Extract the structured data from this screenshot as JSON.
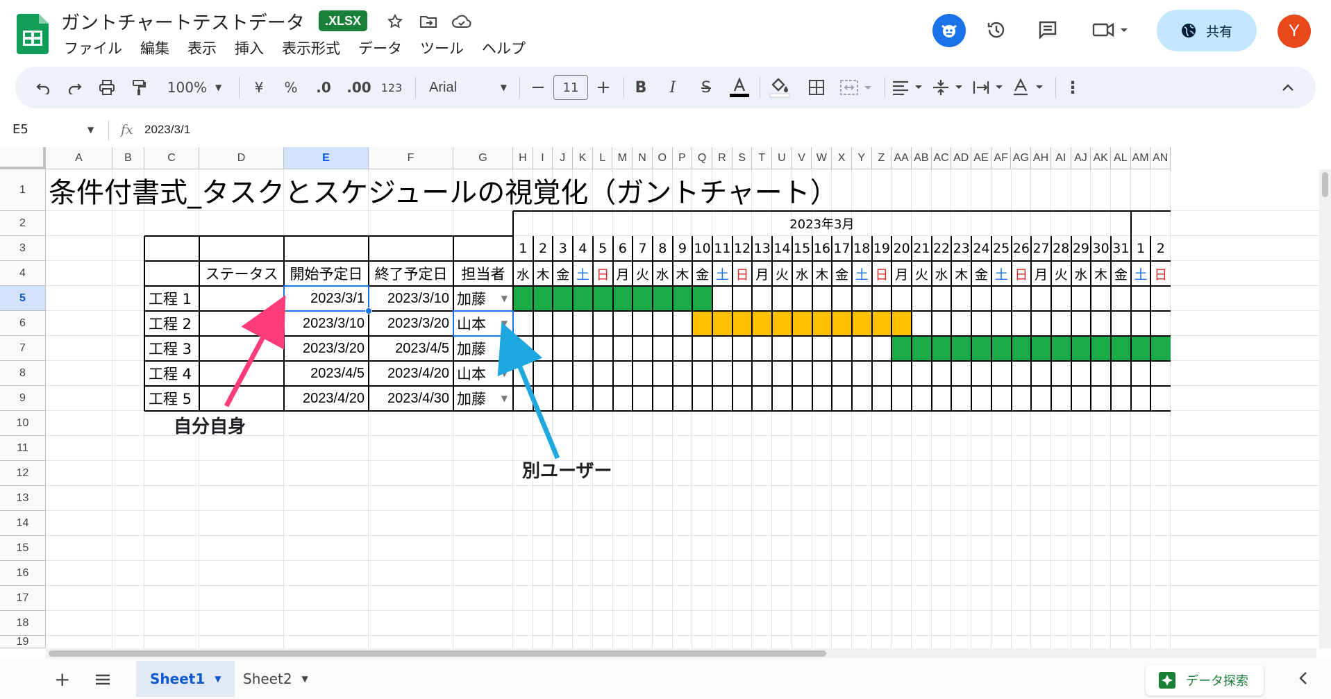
{
  "doc": {
    "title": "ガントチャートテストデータ",
    "badge": ".XLSX"
  },
  "menu": [
    "ファイル",
    "編集",
    "表示",
    "挿入",
    "表示形式",
    "データ",
    "ツール",
    "ヘルプ"
  ],
  "share_label": "共有",
  "avatar_letter": "Y",
  "toolbar": {
    "zoom": "100%",
    "currency": "¥",
    "percent": "%",
    "dec_less": ".0",
    "dec_more": ".00",
    "fmt123": "123",
    "font": "Arial",
    "font_size": "11"
  },
  "formula": {
    "cell_ref": "E5",
    "value": "2023/3/1"
  },
  "columns": [
    "A",
    "B",
    "C",
    "D",
    "E",
    "F",
    "G",
    "H",
    "I",
    "J",
    "K",
    "L",
    "M",
    "N",
    "O",
    "P",
    "Q",
    "R",
    "S",
    "T",
    "U",
    "V",
    "W",
    "X",
    "Y",
    "Z",
    "AA",
    "AB",
    "AC",
    "AD",
    "AE",
    "AF",
    "AG",
    "AH",
    "AI",
    "AJ",
    "AK",
    "AL",
    "AM",
    "AN"
  ],
  "rows": [
    "1",
    "2",
    "3",
    "4",
    "5",
    "6",
    "7",
    "8",
    "9",
    "10",
    "11",
    "12",
    "13",
    "14",
    "15",
    "16",
    "17",
    "18",
    "19"
  ],
  "sheet": {
    "title": "条件付書式_タスクとスケジュールの視覚化（ガントチャート）",
    "month": "2023年3月",
    "headers": {
      "status": "ステータス",
      "start": "開始予定日",
      "end": "終了予定日",
      "owner": "担当者"
    },
    "days": [
      "1",
      "2",
      "3",
      "4",
      "5",
      "6",
      "7",
      "8",
      "9",
      "10",
      "11",
      "12",
      "13",
      "14",
      "15",
      "16",
      "17",
      "18",
      "19",
      "20",
      "21",
      "22",
      "23",
      "24",
      "25",
      "26",
      "27",
      "28",
      "29",
      "30",
      "31",
      "1",
      "2"
    ],
    "weekdays": [
      "水",
      "木",
      "金",
      "土",
      "日",
      "月",
      "火",
      "水",
      "木",
      "金",
      "土",
      "日",
      "月",
      "火",
      "水",
      "木",
      "金",
      "土",
      "日",
      "月",
      "火",
      "水",
      "木",
      "金",
      "土",
      "日",
      "月",
      "火",
      "水",
      "木",
      "金",
      "土",
      "日"
    ],
    "tasks": [
      {
        "name": "工程 1",
        "start": "2023/3/1",
        "end": "2023/3/10",
        "owner": "加藤",
        "bar_start": 1,
        "bar_end": 10,
        "color": "#1aaa48"
      },
      {
        "name": "工程 2",
        "start": "2023/3/10",
        "end": "2023/3/20",
        "owner": "山本",
        "bar_start": 10,
        "bar_end": 20,
        "color": "#ffc000"
      },
      {
        "name": "工程 3",
        "start": "2023/3/20",
        "end": "2023/4/5",
        "owner": "加藤",
        "bar_start": 20,
        "bar_end": 33,
        "color": "#1aaa48"
      },
      {
        "name": "工程 4",
        "start": "2023/4/5",
        "end": "2023/4/20",
        "owner": "山本"
      },
      {
        "name": "工程 5",
        "start": "2023/4/20",
        "end": "2023/4/30",
        "owner": "加藤"
      }
    ]
  },
  "annotations": {
    "self": "自分自身",
    "other": "別ユーザー",
    "self_color": "#ff3c78",
    "other_color": "#1fa8e0"
  },
  "tabs": {
    "sheet1": "Sheet1",
    "sheet2": "Sheet2",
    "explore": "データ探索"
  },
  "colors": {
    "saturday": "#1a73e8",
    "sunday": "#d93025",
    "selection": "#1a73e8"
  }
}
